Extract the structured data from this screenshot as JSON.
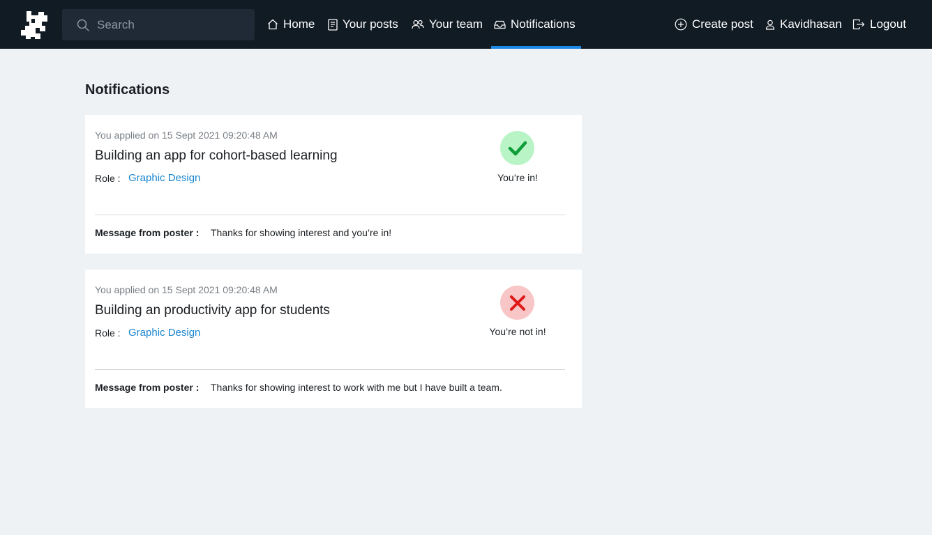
{
  "header": {
    "search_placeholder": "Search",
    "nav": [
      {
        "label": "Home",
        "icon": "home-icon"
      },
      {
        "label": "Your posts",
        "icon": "document-icon"
      },
      {
        "label": "Your team",
        "icon": "team-icon"
      },
      {
        "label": "Notifications",
        "icon": "inbox-icon",
        "active": true
      }
    ],
    "right": [
      {
        "label": "Create post",
        "icon": "plus-circle-icon"
      },
      {
        "label": "Kavidhasan",
        "icon": "user-icon"
      },
      {
        "label": "Logout",
        "icon": "logout-icon"
      }
    ]
  },
  "page": {
    "title": "Notifications"
  },
  "notifications": [
    {
      "applied": "You applied on 15 Sept 2021 09:20:48 AM",
      "title": "Building an app for cohort-based learning",
      "role_label": "Role :",
      "role": "Graphic Design",
      "status": "accepted",
      "status_icon": "check-icon",
      "status_text": "You’re in!",
      "message_label": "Message from poster :",
      "message": "Thanks for showing interest and you’re in!"
    },
    {
      "applied": "You applied on 15 Sept 2021 09:20:48 AM",
      "title": "Building an productivity app for students",
      "role_label": "Role :",
      "role": "Graphic Design",
      "status": "rejected",
      "status_icon": "cross-icon",
      "status_text": "You’re not in!",
      "message_label": "Message from poster :",
      "message": "Thanks for showing interest to work with me but I have built a team."
    }
  ],
  "colors": {
    "topbar": "#111b24",
    "accent": "#1e88e5",
    "link": "#1a86d0",
    "success_bg": "#b9f4c6",
    "success": "#0f9d3a",
    "error_bg": "#f8c6c6",
    "error": "#e01919"
  }
}
